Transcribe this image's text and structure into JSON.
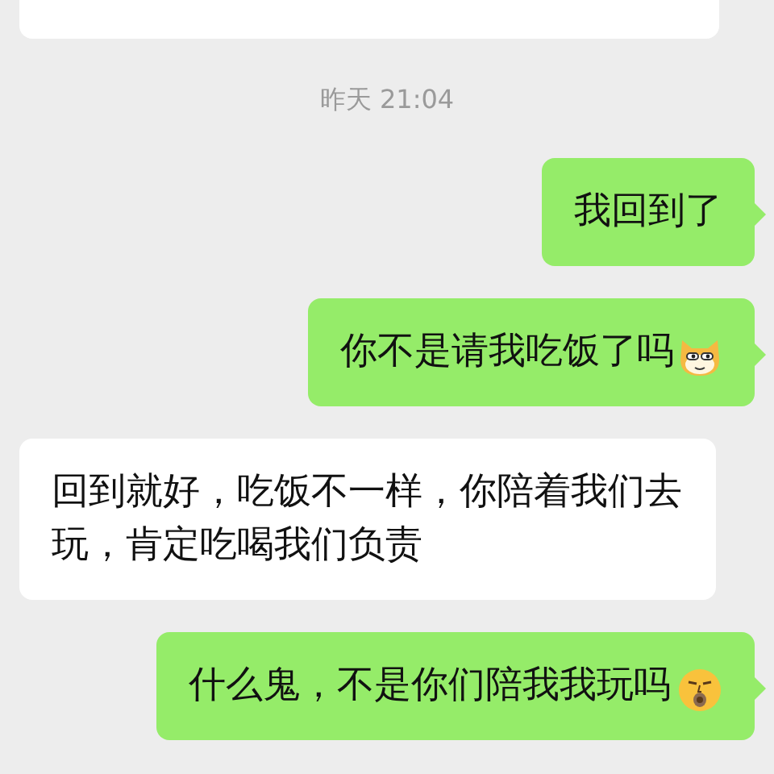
{
  "messages": [
    {
      "kind": "incoming",
      "cut_off": true
    },
    {
      "kind": "time",
      "text": "昨天 21:04"
    },
    {
      "kind": "outgoing",
      "text": "我回到了"
    },
    {
      "kind": "outgoing",
      "text": "你不是请我吃饭了吗",
      "emoji": {
        "kind": "doge"
      }
    },
    {
      "kind": "incoming",
      "text": "回到就好，吃饭不一样，你陪着我们去玩，肯定吃喝我们负责"
    },
    {
      "kind": "outgoing",
      "text": "什么鬼，不是你们陪我我玩吗",
      "emoji": {
        "kind": "yawn"
      }
    }
  ]
}
